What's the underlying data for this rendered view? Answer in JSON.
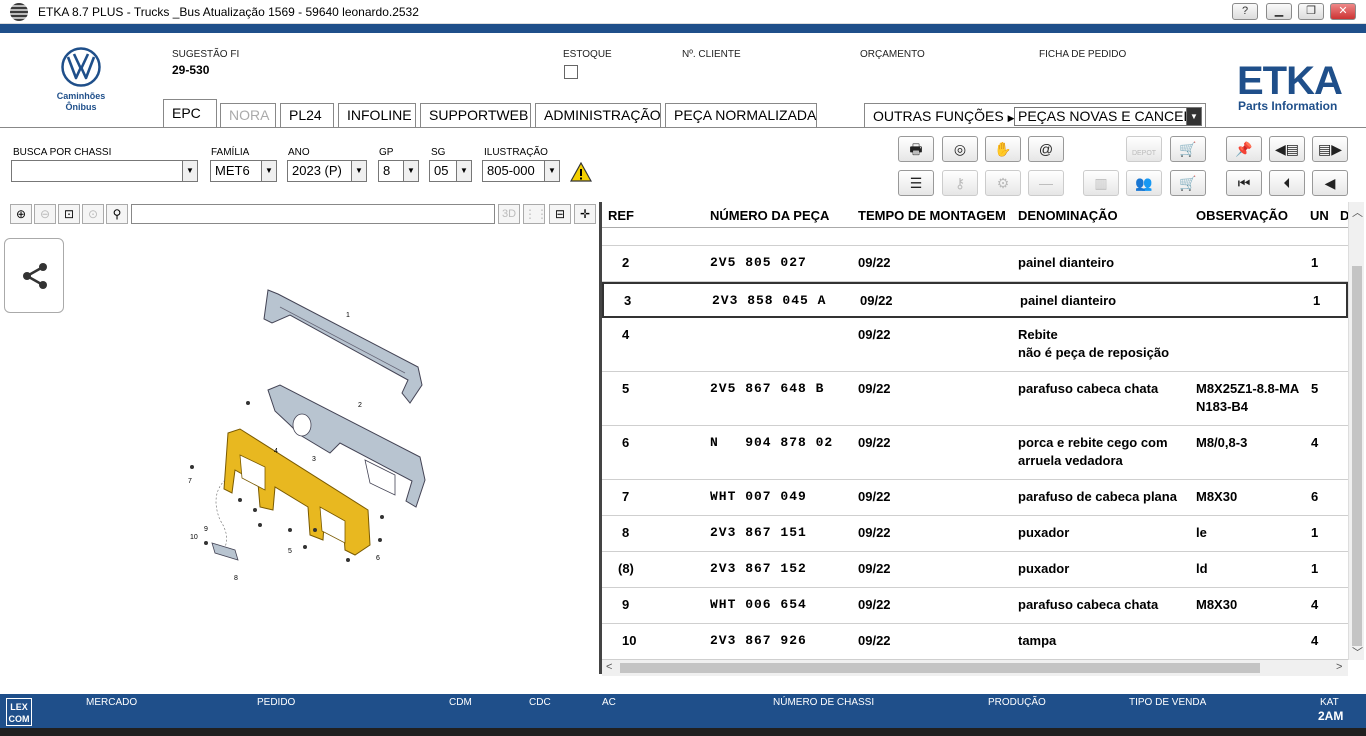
{
  "window": {
    "title": "ETKA 8.7 PLUS - Trucks _Bus Atualização 1569 - 59640 leonardo.2532",
    "help": "?"
  },
  "brand": {
    "text_line1": "Caminhões",
    "text_line2": "Ônibus",
    "product": "ETKA",
    "product_sub": "Parts Information",
    "color": "#1f4f8a"
  },
  "header": {
    "sugestao_label": "SUGESTÃO FI",
    "sugestao_value": "29-530",
    "estoque_label": "ESTOQUE",
    "cliente_label": "Nº. CLIENTE",
    "orcamento_label": "ORÇAMENTO",
    "ficha_label": "FICHA DE PEDIDO"
  },
  "tabs": [
    "EPC",
    "NORA",
    "PL24",
    "INFOLINE",
    "SUPPORTWEB",
    "ADMINISTRAÇÃO",
    "PEÇA NORMALIZADA"
  ],
  "outras": {
    "label": "OUTRAS FUNÇÕES",
    "selected": "PEÇAS NOVAS E CANCEL."
  },
  "filters": {
    "chassi_label": "BUSCA POR CHASSI",
    "chassi_value": "",
    "familia_label": "FAMÍLIA",
    "familia_value": "MET6",
    "ano_label": "ANO",
    "ano_value": "2023 (P)",
    "gp_label": "GP",
    "gp_value": "8",
    "sg_label": "SG",
    "sg_value": "05",
    "ilustracao_label": "ILUSTRAÇÃO",
    "ilustracao_value": "805-000"
  },
  "toolbar": {
    "depot_label": "DEPOT"
  },
  "viewer": {
    "btn_3d": "3D",
    "search_value": ""
  },
  "table": {
    "headers": {
      "ref": "REF",
      "numero": "NÚMERO DA PEÇA",
      "tempo": "TEMPO DE MONTAGEM",
      "denominacao": "DENOMINAÇÃO",
      "observacao": "OBSERVAÇÃO",
      "un": "UN",
      "d": "D"
    },
    "rows": [
      {
        "ref": "2",
        "num": "2V5 805 027",
        "tempo": "09/22",
        "den1": "painel dianteiro",
        "den2": "",
        "obs1": "",
        "obs2": "",
        "un": "1"
      },
      {
        "ref": "3",
        "num": "2V3 858 045 A",
        "tempo": "09/22",
        "den1": "painel dianteiro",
        "den2": "",
        "obs1": "",
        "obs2": "",
        "un": "1"
      },
      {
        "ref": "4",
        "num": "",
        "tempo": "09/22",
        "den1": "Rebite",
        "den2": "não é peça de reposição",
        "obs1": "",
        "obs2": "",
        "un": ""
      },
      {
        "ref": "5",
        "num": "2V5 867 648 B",
        "tempo": "09/22",
        "den1": "parafuso cabeca chata",
        "den2": "",
        "obs1": "M8X25Z1-8.8-MA",
        "obs2": "N183-B4",
        "un": "5"
      },
      {
        "ref": "6",
        "num": "N   904 878 02",
        "tempo": "09/22",
        "den1": "porca e rebite cego com",
        "den2": "arruela vedadora",
        "obs1": "M8/0,8-3",
        "obs2": "",
        "un": "4"
      },
      {
        "ref": "7",
        "num": "WHT 007 049",
        "tempo": "09/22",
        "den1": "parafuso de cabeca plana",
        "den2": "",
        "obs1": "M8X30",
        "obs2": "",
        "un": "6"
      },
      {
        "ref": "8",
        "num": "2V3 867 151",
        "tempo": "09/22",
        "den1": "puxador",
        "den2": "",
        "obs1": "le",
        "obs2": "",
        "un": "1"
      },
      {
        "ref": "(8)",
        "num": "2V3 867 152",
        "tempo": "09/22",
        "den1": "puxador",
        "den2": "",
        "obs1": "ld",
        "obs2": "",
        "un": "1"
      },
      {
        "ref": "9",
        "num": "WHT 006 654",
        "tempo": "09/22",
        "den1": "parafuso cabeca chata",
        "den2": "",
        "obs1": "M8X30",
        "obs2": "",
        "un": "4"
      },
      {
        "ref": "10",
        "num": "2V3 867 926",
        "tempo": "09/22",
        "den1": "tampa",
        "den2": "",
        "obs1": "",
        "obs2": "",
        "un": "4"
      }
    ]
  },
  "drawing": {
    "callouts": [
      "1",
      "2",
      "3",
      "4",
      "5",
      "6",
      "7",
      "8",
      "9",
      "10"
    ],
    "highlight_color": "#e8b820"
  },
  "statusbar": {
    "logo_line1": "LEX",
    "logo_line2": "COM",
    "mercado": "MERCADO",
    "pedido": "PEDIDO",
    "cdm": "CDM",
    "cdc": "CDC",
    "ac": "AC",
    "chassi": "NÚMERO DE CHASSI",
    "producao": "PRODUÇÃO",
    "tipo_venda": "TIPO DE VENDA",
    "kat_label": "KAT",
    "kat_value": "2AM"
  }
}
